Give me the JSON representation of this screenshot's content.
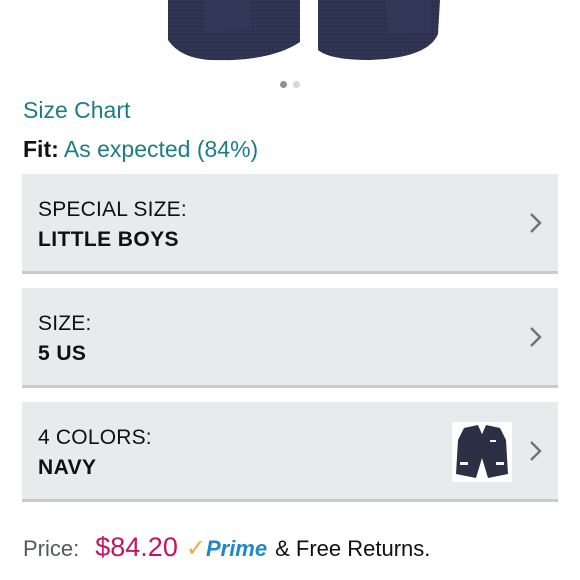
{
  "carousel": {
    "total": 2,
    "active_index": 0
  },
  "size_chart": {
    "label": "Size Chart"
  },
  "fit": {
    "label": "Fit:",
    "value": "As expected (84%)"
  },
  "selectors": [
    {
      "label": "SPECIAL SIZE:",
      "value": "LITTLE BOYS"
    },
    {
      "label": "SIZE:",
      "value": "5 US"
    },
    {
      "label": "4 COLORS:",
      "value": "NAVY"
    }
  ],
  "price": {
    "label": "Price:",
    "value": "$84.20",
    "prime_check": "✓",
    "prime_label": "Prime",
    "returns": "& Free Returns."
  },
  "colors": {
    "link": "#1e7c86",
    "price": "#c7145f",
    "prime_blue": "#1e88c8",
    "prime_orange": "#f3a847",
    "selector_bg": "#e8eaeb",
    "jacket_navy": "#2b3047"
  },
  "icons": {
    "chevron": "chevron-right-icon",
    "swatch": "navy-jacket-thumbnail"
  }
}
